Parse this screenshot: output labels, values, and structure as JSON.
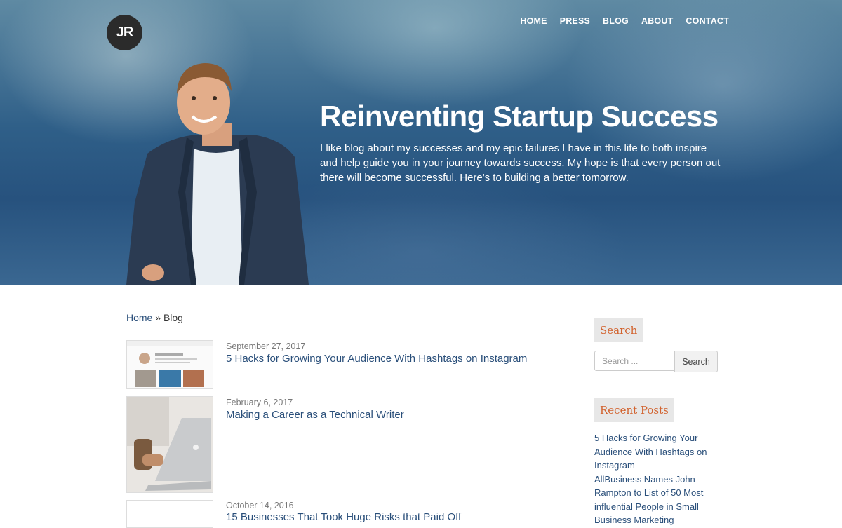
{
  "header": {
    "logo_text": "JR",
    "nav": [
      "HOME",
      "PRESS",
      "BLOG",
      "ABOUT",
      "CONTACT"
    ]
  },
  "hero": {
    "title": "Reinventing Startup Success",
    "text": "I like blog about my successes and my epic failures I have in this life to both inspire and help guide you in your journey towards success. My hope is that every person out there will become successful. Here's to building a better tomorrow."
  },
  "breadcrumb": {
    "home": "Home",
    "separator": " » ",
    "current": "Blog"
  },
  "posts": [
    {
      "date": "September 27, 2017",
      "title": "5 Hacks for Growing Your Audience With Hashtags on Instagram"
    },
    {
      "date": "February 6, 2017",
      "title": "Making a Career as a Technical Writer"
    },
    {
      "date": "October 14, 2016",
      "title": "15 Businesses That Took Huge Risks that Paid Off"
    }
  ],
  "sidebar": {
    "search_title": "Search",
    "search_placeholder": "Search ...",
    "search_button": "Search",
    "recent_title": "Recent Posts",
    "recent_posts": [
      "5 Hacks for Growing Your Audience With Hashtags on Instagram",
      "AllBusiness Names John Rampton to List of 50 Most influential People in Small Business Marketing"
    ]
  },
  "colors": {
    "link": "#2a4f7a",
    "widget_title": "#d2632f",
    "widget_bg": "#e7e7e7",
    "logo_bg": "#2b2b2b"
  }
}
